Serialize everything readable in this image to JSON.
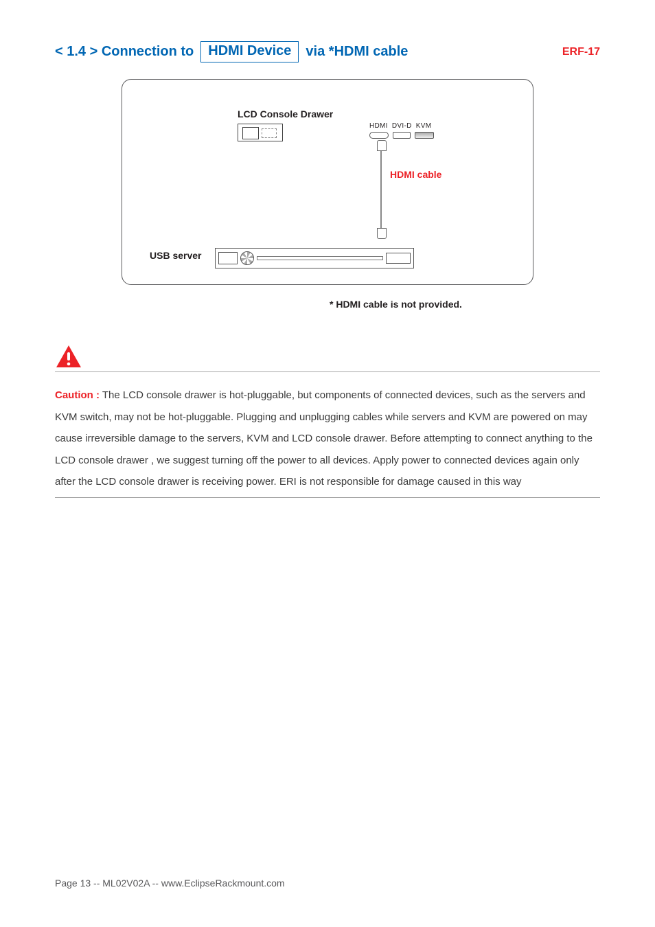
{
  "header": {
    "section_prefix": "< 1.4 > Connection to",
    "boxed_term": "HDMI Device",
    "section_suffix": "via *HDMI cable",
    "product_code": "ERF-17"
  },
  "diagram": {
    "lcd_title": "LCD Console Drawer",
    "port_labels": "HDMI  DVI-D  KVM",
    "cable_label": "HDMI cable",
    "usb_server_label": "USB server"
  },
  "footnote": "* HDMI cable is not provided.",
  "caution": {
    "label": "Caution :",
    "body": " The LCD console drawer is hot-pluggable, but components of connected devices, such as the servers and KVM switch, may not be hot-pluggable. Plugging and unplugging cables while servers and KVM are powered on may cause irreversible damage to the servers, KVM and LCD console drawer. Before attempting to connect anything to the LCD console drawer   , we suggest turning off the power to all devices.  Apply power to connected devices again only after the LCD console drawer is receiving power. ERI is not responsible for damage caused in this way"
  },
  "footer": "Page 13 -- ML02V02A -- www.EclipseRackmount.com"
}
